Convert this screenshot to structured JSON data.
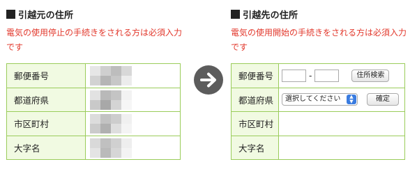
{
  "left": {
    "heading": "引越元の住所",
    "note": "電気の使用停止の手続きをされる方は必須入力です",
    "rows": [
      "郵便番号",
      "都道府県",
      "市区町村",
      "大字名"
    ]
  },
  "right": {
    "heading": "引越先の住所",
    "note": "電気の使用開始の手続きをされる方は必須入力です",
    "rows": [
      "郵便番号",
      "都道府県",
      "市区町村",
      "大字名"
    ],
    "zip_separator": "-",
    "zip_search_label": "住所検索",
    "prefecture_select_value": "選択してください",
    "confirm_label": "確定"
  },
  "colors": {
    "note_red": "#e2382c",
    "border_green": "#9acc5a",
    "label_bg": "#f1fae2",
    "arrow_gray": "#5c5c5c",
    "select_blue": "#3a7ce0"
  },
  "icons": {
    "arrow": "arrow-right-circle-icon",
    "select_toggle": "chevron-updown-icon"
  }
}
